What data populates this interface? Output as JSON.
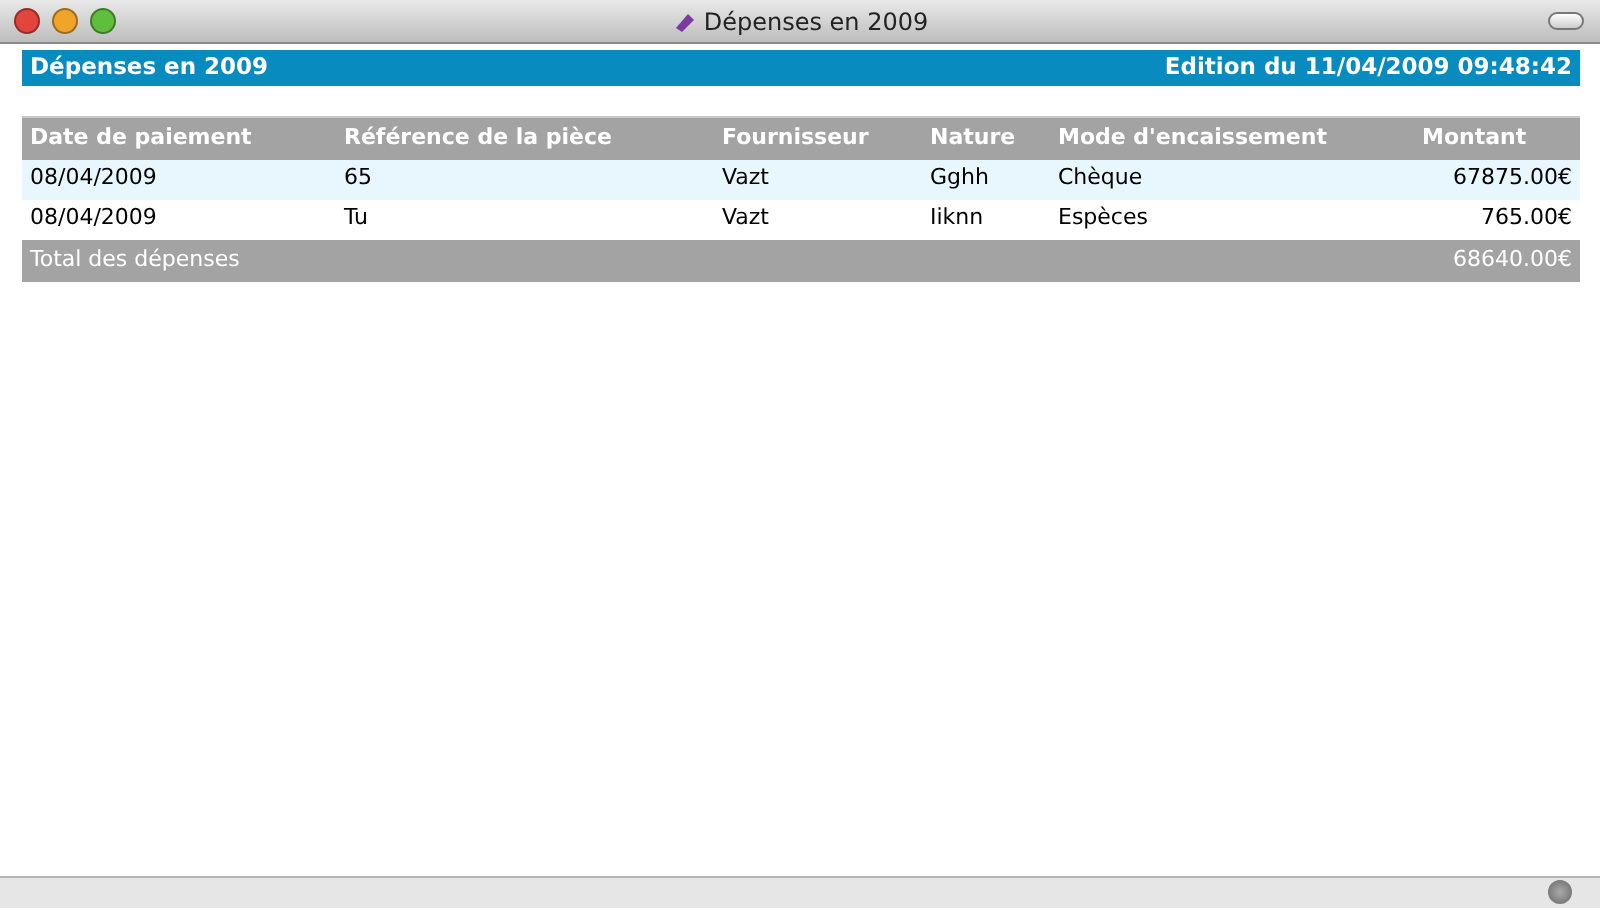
{
  "window": {
    "title": "Dépenses en 2009"
  },
  "report": {
    "title": "Dépenses en 2009",
    "edition": "Edition du 11/04/2009 09:48:42"
  },
  "table": {
    "columns": [
      "Date de paiement",
      "Référence de la pièce",
      "Fournisseur",
      "Nature",
      "Mode d'encaissement",
      "Montant"
    ],
    "rows": [
      [
        "08/04/2009",
        "65",
        "Vazt",
        "Gghh",
        "Chèque",
        "67875.00€"
      ],
      [
        "08/04/2009",
        "Tu",
        "Vazt",
        "Iiknn",
        "Espèces",
        "765.00€"
      ]
    ],
    "total": {
      "label": "Total des dépenses",
      "amount": "68640.00€"
    }
  }
}
